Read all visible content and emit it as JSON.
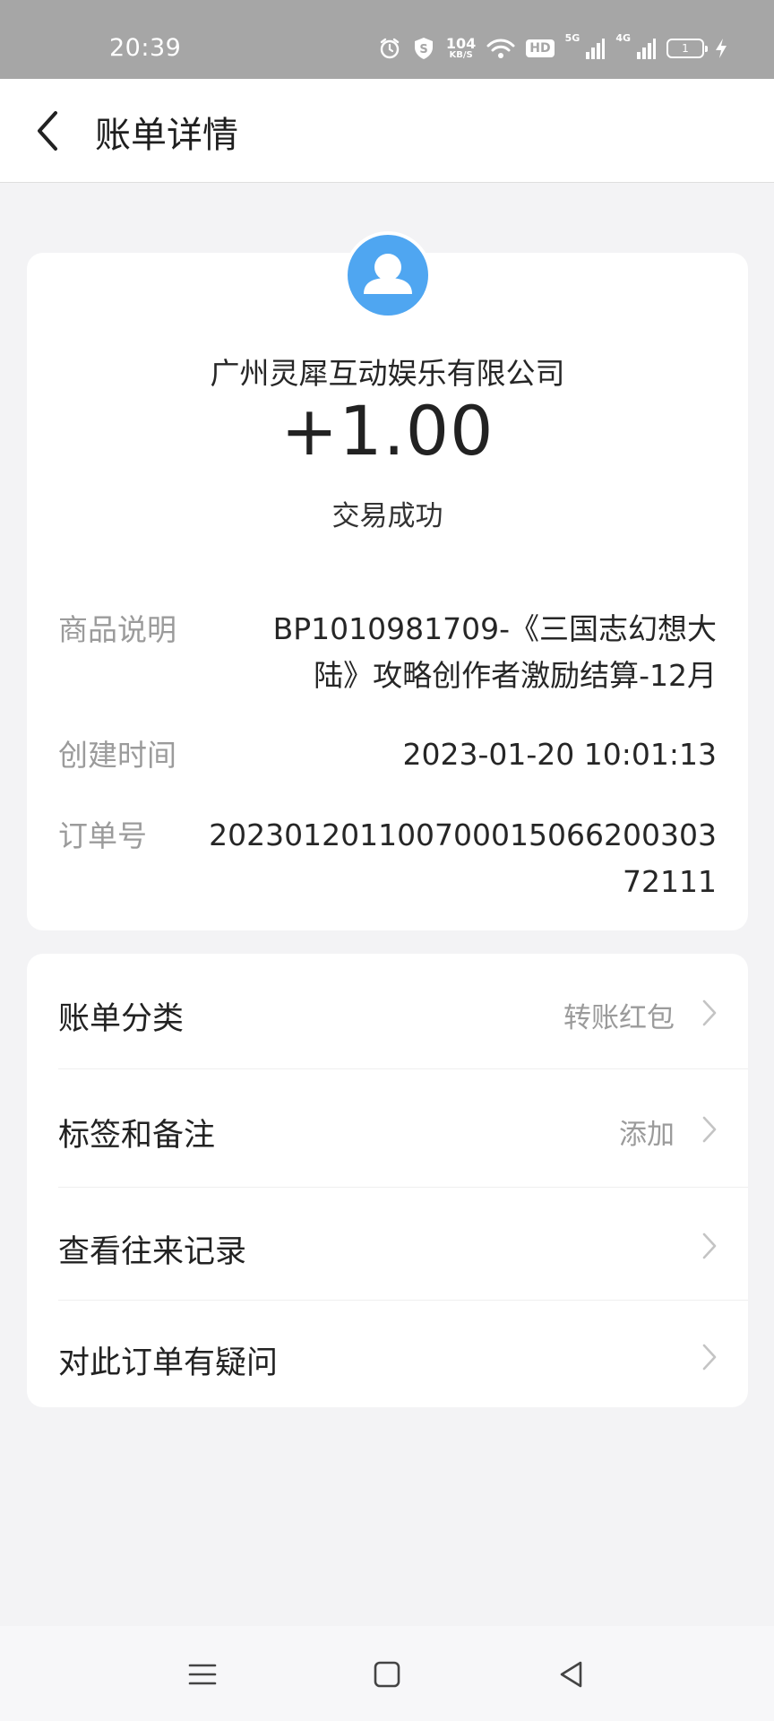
{
  "status_bar": {
    "time": "20:39",
    "net_speed_value": "104",
    "net_speed_unit": "KB/S",
    "hd_label": "HD",
    "signal1_label": "5G",
    "signal2_label": "4G",
    "battery_level": "1",
    "icons": [
      "alarm-icon",
      "shield-icon",
      "wifi-icon",
      "signal-icon",
      "battery-icon",
      "charging-icon"
    ]
  },
  "header": {
    "title": "账单详情",
    "back_icon": "chevron-left-icon"
  },
  "transaction": {
    "avatar_icon": "user-icon",
    "merchant": "广州灵犀互动娱乐有限公司",
    "amount": "+1.00",
    "status": "交易成功",
    "colors": {
      "avatar": "#4fa6f1"
    }
  },
  "details": {
    "description_label": "商品说明",
    "description_value": "BP1010981709-《三国志幻想大陆》攻略创作者激励结算-12月",
    "created_label": "创建时间",
    "created_value": "2023-01-20 10:01:13",
    "order_label": "订单号",
    "order_value": "20230120110070001506620030372111"
  },
  "menu": {
    "items": [
      {
        "label": "账单分类",
        "value": "转账红包"
      },
      {
        "label": "标签和备注",
        "value": "添加"
      },
      {
        "label": "查看往来记录",
        "value": ""
      },
      {
        "label": "对此订单有疑问",
        "value": ""
      }
    ]
  },
  "nav_bar": {
    "icons": [
      "menu-icon",
      "home-icon",
      "back-icon"
    ]
  }
}
